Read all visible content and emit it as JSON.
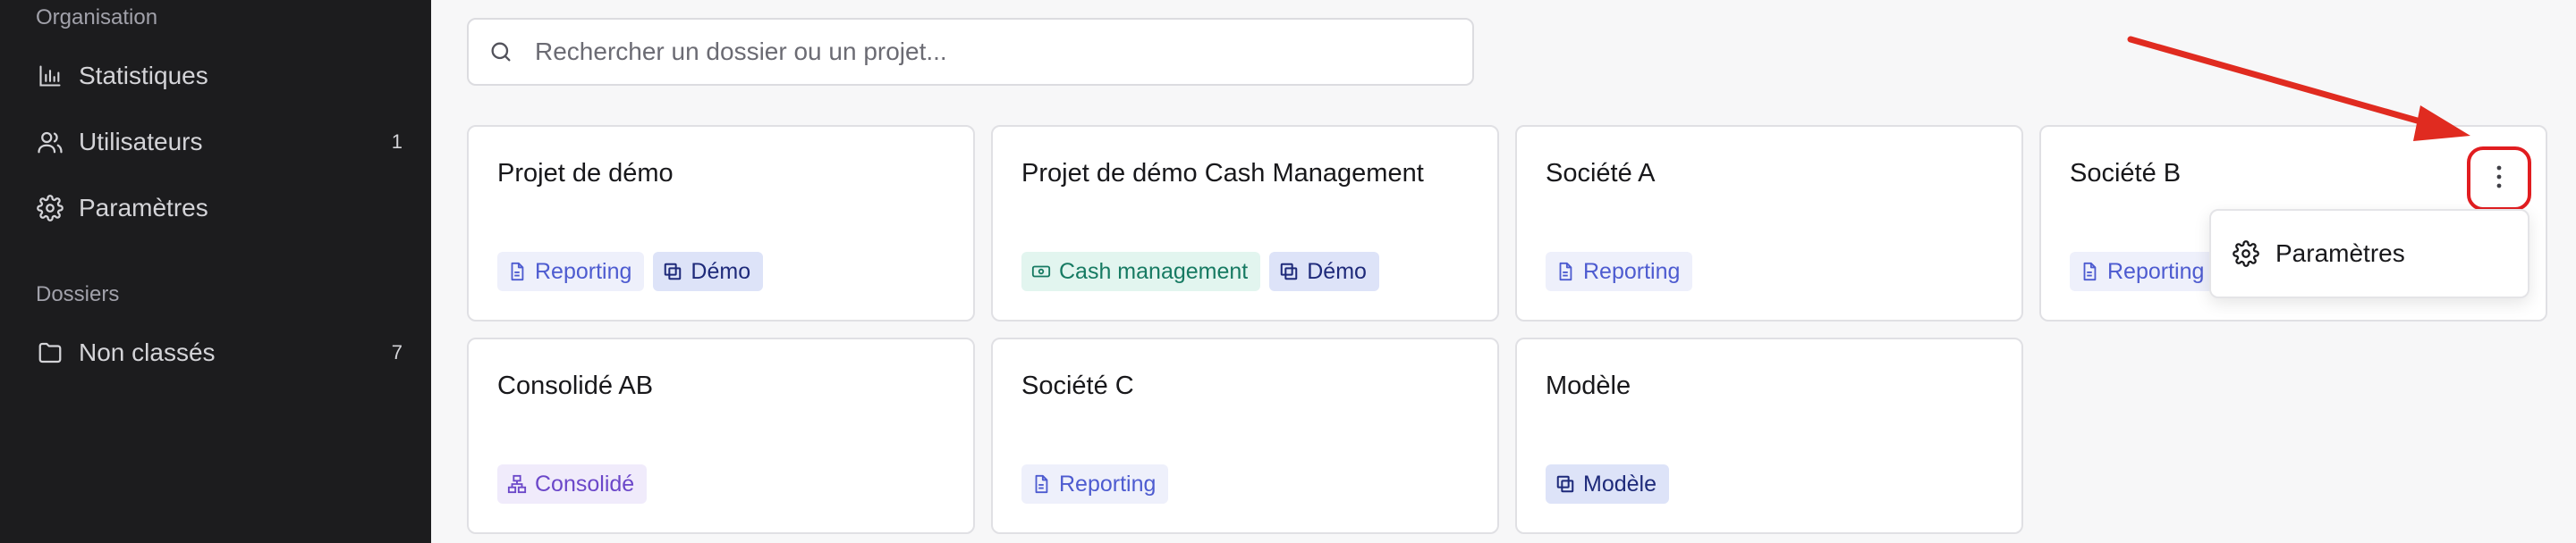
{
  "sidebar": {
    "org_title": "Organisation",
    "org_items": [
      {
        "label": "Statistiques",
        "icon": "bar-chart-icon",
        "count": ""
      },
      {
        "label": "Utilisateurs",
        "icon": "users-icon",
        "count": "1"
      },
      {
        "label": "Paramètres",
        "icon": "gear-icon",
        "count": ""
      }
    ],
    "folders_title": "Dossiers",
    "folder_items": [
      {
        "label": "Non classés",
        "icon": "folder-icon",
        "count": "7"
      }
    ]
  },
  "search": {
    "placeholder": "Rechercher un dossier ou un projet..."
  },
  "projects": [
    {
      "title": "Projet de démo",
      "tags": [
        {
          "label": "Reporting",
          "type": "reporting"
        },
        {
          "label": "Démo",
          "type": "demo"
        }
      ]
    },
    {
      "title": "Projet de démo Cash Management",
      "tags": [
        {
          "label": "Cash management",
          "type": "cash"
        },
        {
          "label": "Démo",
          "type": "demo"
        }
      ]
    },
    {
      "title": "Société A",
      "tags": [
        {
          "label": "Reporting",
          "type": "reporting"
        }
      ]
    },
    {
      "title": "Société B",
      "tags": [
        {
          "label": "Reporting",
          "type": "reporting"
        }
      ]
    },
    {
      "title": "Consolidé AB",
      "tags": [
        {
          "label": "Consolidé",
          "type": "consolide"
        }
      ]
    },
    {
      "title": "Société C",
      "tags": [
        {
          "label": "Reporting",
          "type": "reporting"
        }
      ]
    },
    {
      "title": "Modèle",
      "tags": [
        {
          "label": "Modèle",
          "type": "modele"
        }
      ]
    }
  ],
  "dropdown": {
    "items": [
      {
        "label": "Paramètres",
        "icon": "gear-icon"
      }
    ]
  },
  "colors": {
    "sidebar_bg": "#1c1c1e",
    "highlight": "#e11d20",
    "annotation_arrow": "#e02b20"
  }
}
